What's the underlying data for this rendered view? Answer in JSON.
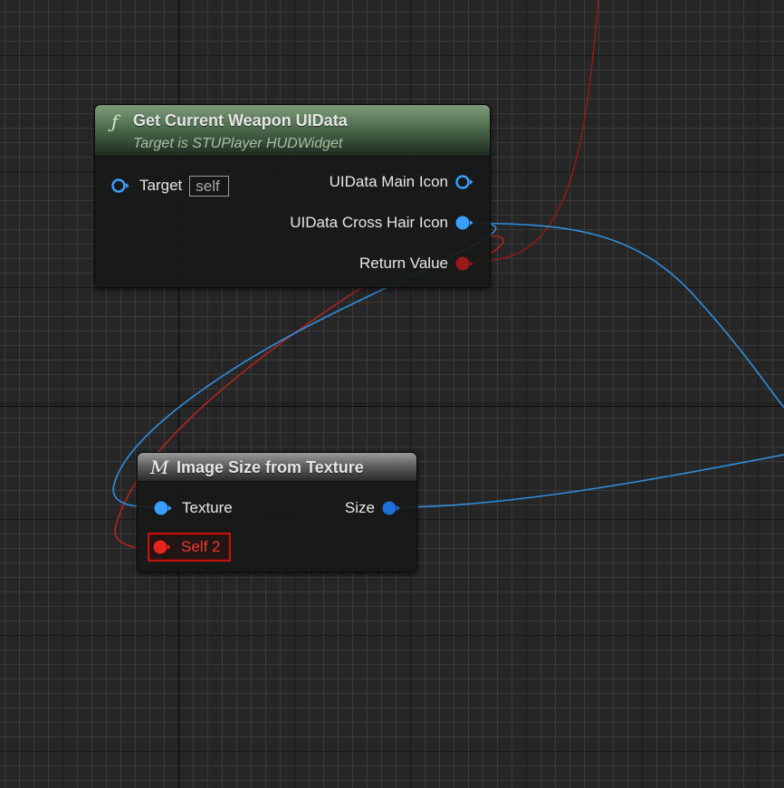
{
  "colors": {
    "graph_background": "#262626",
    "object_pin": "#3aa0ff",
    "object_pin_dark": "#1e6fd9",
    "struct_pin": "#9a1a1a",
    "error": "#e8251c",
    "function_header": "#6f8f6a",
    "macro_header": "#7a7a7a"
  },
  "nodes": {
    "weapon": {
      "icon": "function-icon",
      "icon_glyph": "ƒ",
      "title": "Get Current Weapon UIData",
      "subtitle": "Target is STUPlayer HUDWidget",
      "inputs": [
        {
          "label": "Target",
          "default_value": "self",
          "pin_type": "object",
          "connected": false
        }
      ],
      "outputs": [
        {
          "label": "UIData Main Icon",
          "pin_type": "object",
          "connected": false
        },
        {
          "label": "UIData Cross Hair Icon",
          "pin_type": "object",
          "connected": true
        },
        {
          "label": "Return Value",
          "pin_type": "struct",
          "connected": true
        }
      ]
    },
    "image_size": {
      "icon": "macro-icon",
      "icon_glyph": "M",
      "title": "Image Size from Texture",
      "inputs": [
        {
          "label": "Texture",
          "pin_type": "object",
          "connected": true
        },
        {
          "label": "Self 2",
          "pin_type": "struct",
          "connected": true,
          "error": true
        }
      ],
      "outputs": [
        {
          "label": "Size",
          "pin_type": "object",
          "connected": true
        }
      ]
    }
  }
}
